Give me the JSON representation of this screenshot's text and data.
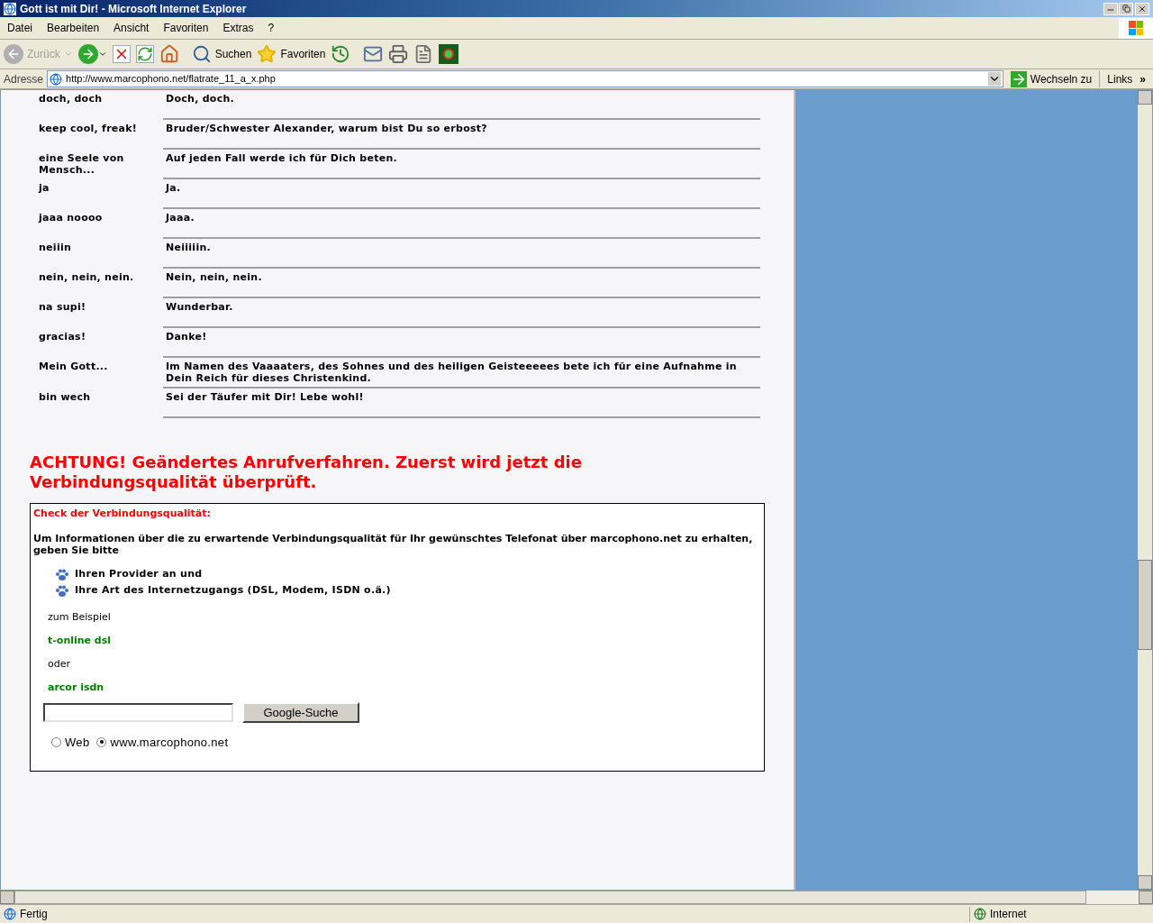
{
  "window": {
    "title": "Gott ist mit Dir! - Microsoft Internet Explorer"
  },
  "menu": [
    "Datei",
    "Bearbeiten",
    "Ansicht",
    "Favoriten",
    "Extras",
    "?"
  ],
  "toolbar": {
    "back": {
      "label": "Zurück",
      "disabled": true
    },
    "search": "Suchen",
    "favorites": "Favoriten"
  },
  "address": {
    "label": "Adresse",
    "url": "http://www.marcophono.net/flatrate_11_a_x.php",
    "go": "Wechseln zu",
    "links": "Links",
    "more": "»"
  },
  "rows": [
    {
      "term": "doch, doch",
      "meaning": "Doch, doch."
    },
    {
      "term": "keep cool, freak!",
      "meaning": "Bruder/Schwester Alexander, warum bist Du so erbost?"
    },
    {
      "term": "eine Seele von Mensch...",
      "meaning": "Auf jeden Fall werde ich für Dich beten."
    },
    {
      "term": "ja",
      "meaning": "Ja."
    },
    {
      "term": "jaaa noooo",
      "meaning": "Jaaa."
    },
    {
      "term": "neiiin",
      "meaning": "Neiiiiin."
    },
    {
      "term": "nein, nein, nein.",
      "meaning": "Nein, nein, nein."
    },
    {
      "term": "na supi!",
      "meaning": "Wunderbar."
    },
    {
      "term": "gracias!",
      "meaning": "Danke!"
    },
    {
      "term": "Mein Gott...",
      "meaning": "Im Namen des Vaaaaters, des Sohnes und des heiligen Geisteeeees bete ich für eine Aufnahme in Dein Reich für dieses Christenkind."
    },
    {
      "term": "bin wech",
      "meaning": "Sei der Täufer mit Dir! Lebe wohl!"
    }
  ],
  "warning": "ACHTUNG! Geändertes Anrufverfahren. Zuerst wird jetzt die Verbindungsqualität überprüft.",
  "check": {
    "heading": "Check der Verbindungsqualität:",
    "intro": "Um Informationen über die zu erwartende Verbindungsqualität für Ihr gewünschtes Telefonat über marcophono.net zu erhalten, geben Sie bitte",
    "bullets": [
      "Ihren Provider an und",
      "Ihre Art des Internetzugangs (DSL, Modem, ISDN o.ä.)"
    ],
    "lines": [
      {
        "kind": "plain",
        "text": "zum Beispiel"
      },
      {
        "kind": "example",
        "text": "t-online dsl"
      },
      {
        "kind": "plain",
        "text": "oder"
      },
      {
        "kind": "example",
        "text": "arcor isdn"
      }
    ]
  },
  "search": {
    "button": "Google-Suche",
    "radios": [
      {
        "label": "Web",
        "selected": false
      },
      {
        "label": "www.marcophono.net",
        "selected": true
      }
    ]
  },
  "status_bar": {
    "text": "Fertig",
    "zone": "Internet"
  }
}
